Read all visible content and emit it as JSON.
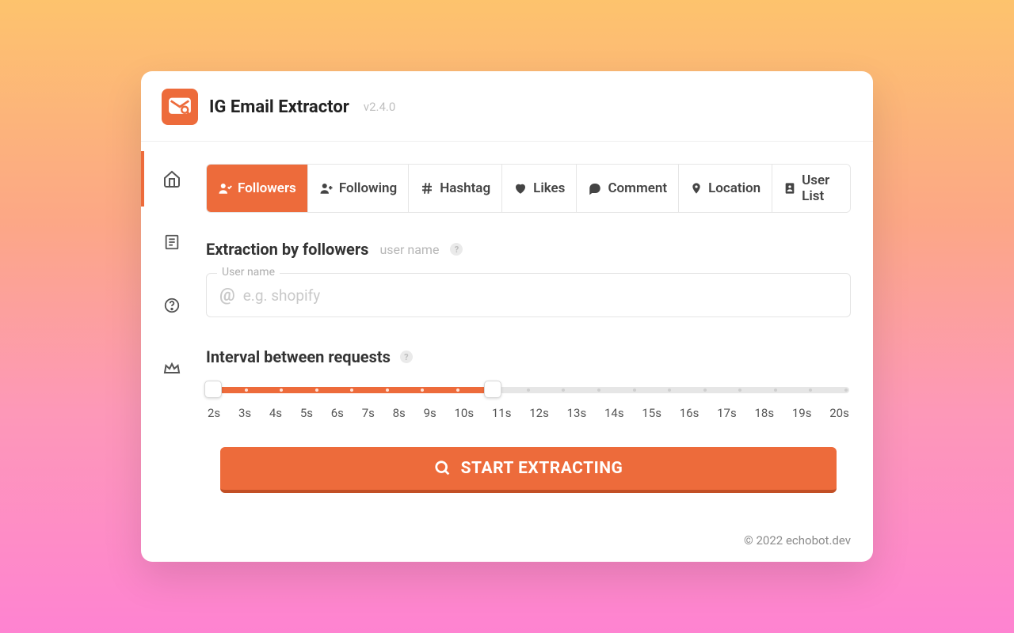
{
  "header": {
    "title": "IG Email Extractor",
    "version": "v2.4.0"
  },
  "sidebar": {
    "items": [
      "home",
      "list",
      "help",
      "crown"
    ]
  },
  "tabs": [
    {
      "icon": "user-check",
      "label": "Followers"
    },
    {
      "icon": "user-plus",
      "label": "Following"
    },
    {
      "icon": "hash",
      "label": "Hashtag"
    },
    {
      "icon": "heart",
      "label": "Likes"
    },
    {
      "icon": "comment",
      "label": "Comment"
    },
    {
      "icon": "location",
      "label": "Location"
    },
    {
      "icon": "contact",
      "label": "User List"
    }
  ],
  "extraction": {
    "title": "Extraction by followers",
    "subtitle": "user name",
    "field_label": "User name",
    "at": "@",
    "placeholder": "e.g. shopify"
  },
  "interval": {
    "title": "Interval between requests",
    "ticks": [
      "2s",
      "3s",
      "4s",
      "5s",
      "6s",
      "7s",
      "8s",
      "9s",
      "10s",
      "11s",
      "12s",
      "13s",
      "14s",
      "15s",
      "16s",
      "17s",
      "18s",
      "19s",
      "20s"
    ],
    "range_min": 2,
    "range_max": 20,
    "value_low": 2,
    "value_high": 10
  },
  "cta": "START EXTRACTING",
  "footer": "© 2022 echobot.dev"
}
